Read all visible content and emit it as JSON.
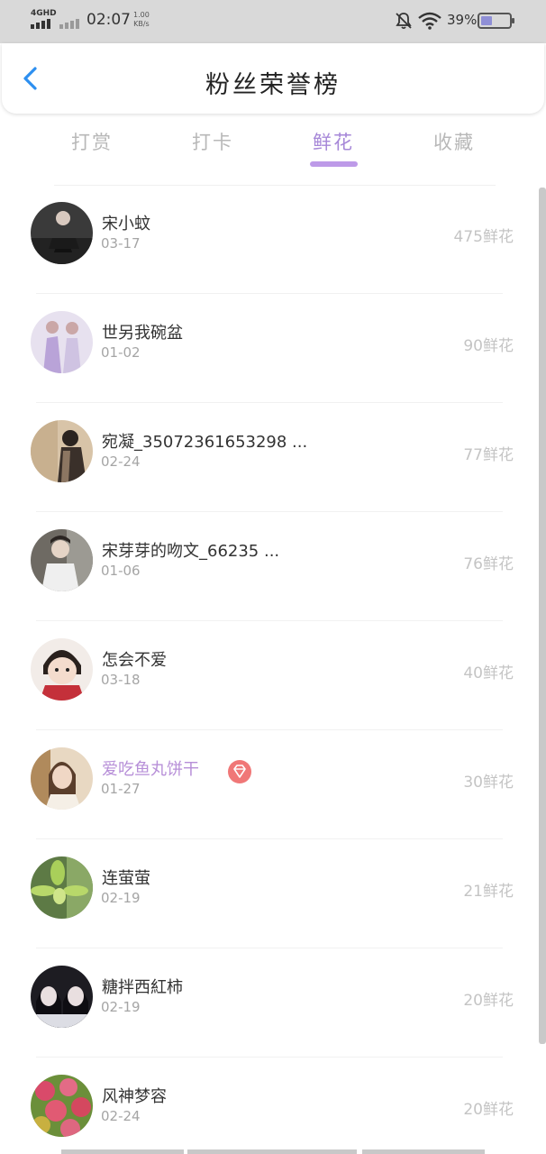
{
  "status_bar": {
    "network": "4GHD",
    "time": "02:07",
    "speed_value": "1.00",
    "speed_unit": "KB/s",
    "battery_text": "39%",
    "battery_level": 0.39
  },
  "header": {
    "title": "粉丝荣誉榜"
  },
  "tabs": [
    {
      "label": "打赏",
      "active": false
    },
    {
      "label": "打卡",
      "active": false
    },
    {
      "label": "鲜花",
      "active": true
    },
    {
      "label": "收藏",
      "active": false
    }
  ],
  "accent_color": "#bd9ae8",
  "fans": [
    {
      "name": "宋小蚊",
      "date": "03-17",
      "amount": "475鲜花",
      "avatar": "photo-dark-person-avatar"
    },
    {
      "name": "世另我碗盆",
      "date": "01-02",
      "amount": "90鲜花",
      "avatar": "photo-two-people-avatar"
    },
    {
      "name": "宛凝_35072361653298 ...",
      "date": "02-24",
      "amount": "77鲜花",
      "avatar": "photo-girl-avatar"
    },
    {
      "name": "宋芽芽的吻文_66235 ...",
      "date": "01-06",
      "amount": "76鲜花",
      "avatar": "photo-boy-avatar"
    },
    {
      "name": "怎会不爱",
      "date": "03-18",
      "amount": "40鲜花",
      "avatar": "photo-child-avatar"
    },
    {
      "name": "爱吃鱼丸饼干",
      "date": "01-27",
      "amount": "30鲜花",
      "avatar": "photo-woman-avatar",
      "special": true
    },
    {
      "name": "连萤萤",
      "date": "02-19",
      "amount": "21鲜花",
      "avatar": "photo-orchid-avatar"
    },
    {
      "name": "糖拌西紅柿",
      "date": "02-19",
      "amount": "20鲜花",
      "avatar": "photo-couple-avatar"
    },
    {
      "name": "风神梦容",
      "date": "02-24",
      "amount": "20鲜花",
      "avatar": "photo-fruit-avatar"
    }
  ]
}
